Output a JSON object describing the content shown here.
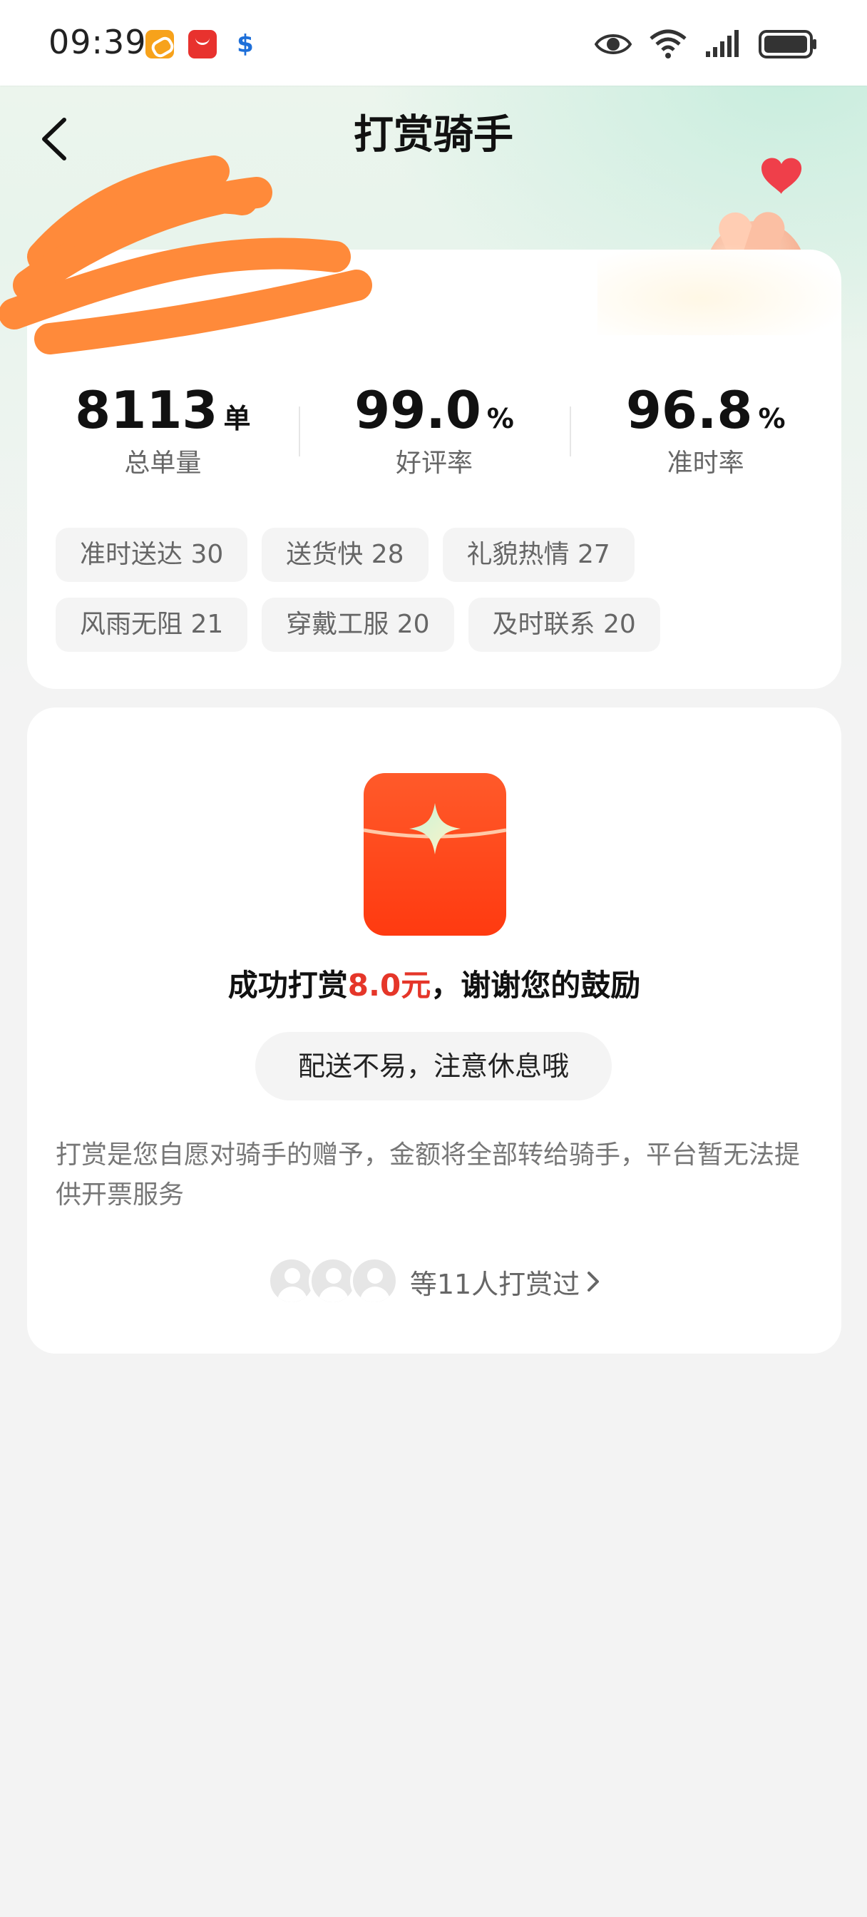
{
  "status_bar": {
    "time": "09:39",
    "apps": [
      "meituan-icon",
      "huawei-store-icon",
      "alipay-icon"
    ],
    "app_glyph_3": "$"
  },
  "nav": {
    "title": "打赏骑手"
  },
  "stats": [
    {
      "value": "8113",
      "unit": "单",
      "label": "总单量"
    },
    {
      "value": "99.0",
      "unit": "%",
      "label": "好评率"
    },
    {
      "value": "96.8",
      "unit": "%",
      "label": "准时率"
    }
  ],
  "tags": [
    [
      "准时送达 30",
      "送货快 28",
      "礼貌热情 27"
    ],
    [
      "风雨无阻 21",
      "穿戴工服 20",
      "及时联系 20"
    ]
  ],
  "reward": {
    "msg_prefix": "成功打赏",
    "amount": "8.0元",
    "msg_suffix": "，谢谢您的鼓励",
    "cheer": "配送不易，注意休息哦",
    "notice": "打赏是您自愿对骑手的赠予，金额将全部转给骑手，平台暂无法提供开票服务",
    "tippers_label": "等11人打赏过"
  },
  "colors": {
    "accent_red": "#e53629",
    "envelope": "#ff4a1c"
  }
}
